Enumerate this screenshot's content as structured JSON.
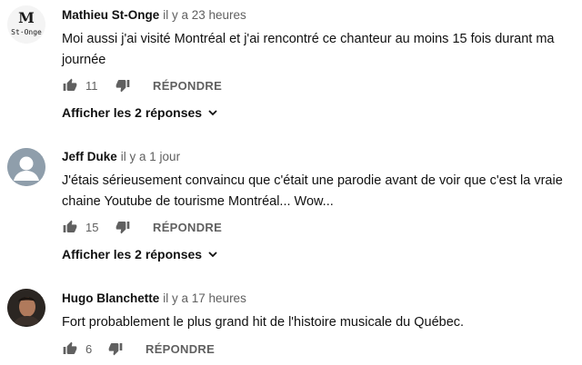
{
  "comments": [
    {
      "author": "Mathieu St-Onge",
      "time": "il y a 23 heures",
      "text": "Moi aussi j'ai visité Montréal et j'ai rencontré ce chanteur au moins 15 fois durant ma journée",
      "likes": "11",
      "reply_label": "RÉPONDRE",
      "replies_label": "Afficher les 2 réponses",
      "avatar_icon": "logo-avatar",
      "avatar_text": "M St·Onge"
    },
    {
      "author": "Jeff Duke",
      "time": "il y a 1 jour",
      "text": "J'étais sérieusement convaincu que c'était une parodie avant de voir que c'est la vraie chaine Youtube de tourisme Montréal... Wow...",
      "likes": "15",
      "reply_label": "RÉPONDRE",
      "replies_label": "Afficher les 2 réponses",
      "avatar_icon": "default-user-icon"
    },
    {
      "author": "Hugo Blanchette",
      "time": "il y a 17 heures",
      "text": "Fort probablement le plus grand hit de l'histoire musicale du Québec.",
      "likes": "6",
      "reply_label": "RÉPONDRE",
      "avatar_icon": "photo-avatar"
    }
  ],
  "colors": {
    "text": "#111111",
    "secondary": "#606060",
    "icon": "#606060"
  }
}
